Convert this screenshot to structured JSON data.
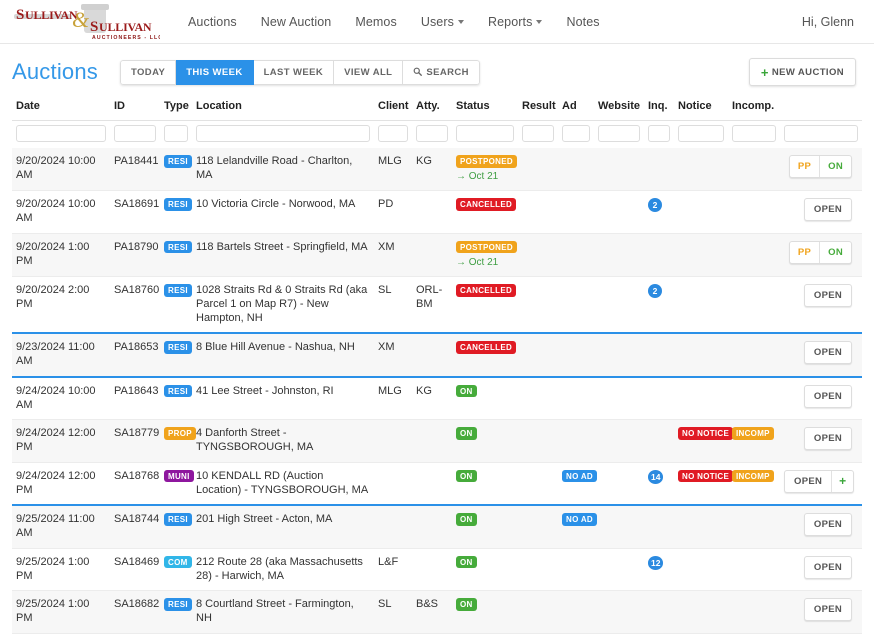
{
  "navbar": {
    "logo_top_left": "SULLIVAN",
    "logo_top_right": "SULLIVAN",
    "logo_amp": "&",
    "logo_sub": "AUCTIONEERS - LLC",
    "links": [
      {
        "label": "Auctions",
        "caret": false
      },
      {
        "label": "New Auction",
        "caret": false
      },
      {
        "label": "Memos",
        "caret": false
      },
      {
        "label": "Users",
        "caret": true
      },
      {
        "label": "Reports",
        "caret": true
      },
      {
        "label": "Notes",
        "caret": false
      }
    ],
    "user_menu": "Hi, Glenn"
  },
  "page": {
    "title": "Auctions",
    "filters": [
      {
        "label": "TODAY",
        "active": false,
        "icon": ""
      },
      {
        "label": "THIS WEEK",
        "active": true,
        "icon": ""
      },
      {
        "label": "LAST WEEK",
        "active": false,
        "icon": ""
      },
      {
        "label": "VIEW ALL",
        "active": false,
        "icon": ""
      },
      {
        "label": "SEARCH",
        "active": false,
        "icon": "search-icon"
      }
    ],
    "new_auction_label": "NEW AUCTION",
    "new_auction_icon": "plus-icon"
  },
  "table": {
    "columns": [
      "Date",
      "ID",
      "Type",
      "Location",
      "Client",
      "Atty.",
      "Status",
      "Result",
      "Ad",
      "Website",
      "Inq.",
      "Notice",
      "Incomp.",
      ""
    ],
    "filter_values": [
      "",
      "",
      "",
      "",
      "",
      "",
      "",
      "",
      "",
      "",
      "",
      "",
      "",
      ""
    ],
    "rows": [
      {
        "group_start": false,
        "alt": true,
        "date": "9/20/2024 10:00 AM",
        "id": "PA18441",
        "type": "RESI",
        "type_class": "b-resi",
        "location": "118 Lelandville Road - Charlton, MA",
        "client": "MLG",
        "atty": "KG",
        "status": "POSTPONED",
        "status_class": "b-postponed",
        "status_note": "→ Oct 21",
        "result": "",
        "ad": "",
        "website": "",
        "inq": "",
        "notice": "",
        "notice_class": "",
        "incomp": "",
        "incomp_class": "",
        "action": "pp-on",
        "action_labels": [
          "PP",
          "ON"
        ]
      },
      {
        "group_start": false,
        "alt": false,
        "date": "9/20/2024 10:00 AM",
        "id": "SA18691",
        "type": "RESI",
        "type_class": "b-resi",
        "location": "10 Victoria Circle - Norwood, MA",
        "client": "PD",
        "atty": "",
        "status": "CANCELLED",
        "status_class": "b-cancelled",
        "status_note": "",
        "result": "",
        "ad": "",
        "website": "",
        "inq": "2",
        "notice": "",
        "notice_class": "",
        "incomp": "",
        "incomp_class": "",
        "action": "open",
        "action_labels": [
          "OPEN"
        ]
      },
      {
        "group_start": false,
        "alt": true,
        "date": "9/20/2024 1:00 PM",
        "id": "PA18790",
        "type": "RESI",
        "type_class": "b-resi",
        "location": "118 Bartels Street - Springfield, MA",
        "client": "XM",
        "atty": "",
        "status": "POSTPONED",
        "status_class": "b-postponed",
        "status_note": "→ Oct 21",
        "result": "",
        "ad": "",
        "website": "",
        "inq": "",
        "notice": "",
        "notice_class": "",
        "incomp": "",
        "incomp_class": "",
        "action": "pp-on",
        "action_labels": [
          "PP",
          "ON"
        ]
      },
      {
        "group_start": false,
        "alt": false,
        "date": "9/20/2024 2:00 PM",
        "id": "SA18760",
        "type": "RESI",
        "type_class": "b-resi",
        "location": "1028 Straits Rd & 0 Straits Rd (aka Parcel 1 on Map R7) - New Hampton, NH",
        "client": "SL",
        "atty": "ORL-BM",
        "status": "CANCELLED",
        "status_class": "b-cancelled",
        "status_note": "",
        "result": "",
        "ad": "",
        "website": "",
        "inq": "2",
        "notice": "",
        "notice_class": "",
        "incomp": "",
        "incomp_class": "",
        "action": "open",
        "action_labels": [
          "OPEN"
        ]
      },
      {
        "group_start": true,
        "alt": true,
        "date": "9/23/2024 11:00 AM",
        "id": "PA18653",
        "type": "RESI",
        "type_class": "b-resi",
        "location": "8 Blue Hill Avenue - Nashua, NH",
        "client": "XM",
        "atty": "",
        "status": "CANCELLED",
        "status_class": "b-cancelled",
        "status_note": "",
        "result": "",
        "ad": "",
        "website": "",
        "inq": "",
        "notice": "",
        "notice_class": "",
        "incomp": "",
        "incomp_class": "",
        "action": "open",
        "action_labels": [
          "OPEN"
        ]
      },
      {
        "group_start": true,
        "alt": false,
        "date": "9/24/2024 10:00 AM",
        "id": "PA18643",
        "type": "RESI",
        "type_class": "b-resi",
        "location": "41 Lee Street - Johnston, RI",
        "client": "MLG",
        "atty": "KG",
        "status": "ON",
        "status_class": "b-on",
        "status_note": "",
        "result": "",
        "ad": "",
        "website": "",
        "inq": "",
        "notice": "",
        "notice_class": "",
        "incomp": "",
        "incomp_class": "",
        "action": "open",
        "action_labels": [
          "OPEN"
        ]
      },
      {
        "group_start": false,
        "alt": true,
        "date": "9/24/2024 12:00 PM",
        "id": "SA18779",
        "type": "PROP",
        "type_class": "b-prop",
        "location": "4 Danforth Street - TYNGSBOROUGH, MA",
        "client": "",
        "atty": "",
        "status": "ON",
        "status_class": "b-on",
        "status_note": "",
        "result": "",
        "ad": "",
        "website": "",
        "inq": "",
        "notice": "NO NOTICE",
        "notice_class": "b-nonotice",
        "incomp": "INCOMP",
        "incomp_class": "b-incomp",
        "action": "open",
        "action_labels": [
          "OPEN"
        ]
      },
      {
        "group_start": false,
        "alt": false,
        "date": "9/24/2024 12:00 PM",
        "id": "SA18768",
        "type": "MUNI",
        "type_class": "b-muni",
        "location": "10 KENDALL RD (Auction Location) - TYNGSBOROUGH, MA",
        "client": "",
        "atty": "",
        "status": "ON",
        "status_class": "b-on",
        "status_note": "",
        "result": "",
        "ad": "NO AD",
        "ad_class": "b-noad",
        "website": "",
        "inq": "14",
        "notice": "NO NOTICE",
        "notice_class": "b-nonotice",
        "incomp": "INCOMP",
        "incomp_class": "b-incomp",
        "action": "split",
        "action_labels": [
          "OPEN",
          "+"
        ]
      },
      {
        "group_start": true,
        "alt": true,
        "date": "9/25/2024 11:00 AM",
        "id": "SA18744",
        "type": "RESI",
        "type_class": "b-resi",
        "location": "201 High Street - Acton, MA",
        "client": "",
        "atty": "",
        "status": "ON",
        "status_class": "b-on",
        "status_note": "",
        "result": "",
        "ad": "NO AD",
        "ad_class": "b-noad",
        "website": "",
        "inq": "",
        "notice": "",
        "notice_class": "",
        "incomp": "",
        "incomp_class": "",
        "action": "open",
        "action_labels": [
          "OPEN"
        ]
      },
      {
        "group_start": false,
        "alt": false,
        "date": "9/25/2024 1:00 PM",
        "id": "SA18469",
        "type": "COM",
        "type_class": "b-com",
        "location": "212 Route 28 (aka Massachusetts 28) - Harwich, MA",
        "client": "L&F",
        "atty": "",
        "status": "ON",
        "status_class": "b-on",
        "status_note": "",
        "result": "",
        "ad": "",
        "website": "",
        "inq": "12",
        "notice": "",
        "notice_class": "",
        "incomp": "",
        "incomp_class": "",
        "action": "open",
        "action_labels": [
          "OPEN"
        ]
      },
      {
        "group_start": false,
        "alt": true,
        "date": "9/25/2024 1:00 PM",
        "id": "SA18682",
        "type": "RESI",
        "type_class": "b-resi",
        "location": "8 Courtland Street - Farmington, NH",
        "client": "SL",
        "atty": "B&S",
        "status": "ON",
        "status_class": "b-on",
        "status_note": "",
        "result": "",
        "ad": "",
        "website": "",
        "inq": "",
        "notice": "",
        "notice_class": "",
        "incomp": "",
        "incomp_class": "",
        "action": "open",
        "action_labels": [
          "OPEN"
        ]
      }
    ]
  }
}
